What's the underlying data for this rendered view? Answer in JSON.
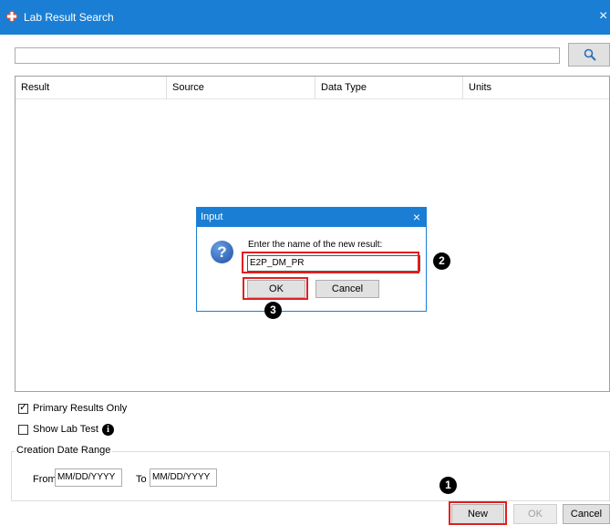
{
  "window": {
    "title": "Lab Result Search",
    "close_glyph": "×",
    "accent": "#1a7fd4"
  },
  "search": {
    "value": "",
    "button_icon": "search-icon"
  },
  "grid": {
    "columns": [
      "Result",
      "Source",
      "Data Type",
      "Units"
    ]
  },
  "options": {
    "primary_results_only": {
      "label": "Primary Results Only",
      "checked": true
    },
    "show_lab_test": {
      "label": "Show Lab Test",
      "checked": false,
      "info_glyph": "i"
    }
  },
  "date_range": {
    "title": "Creation Date Range",
    "from_label": "From",
    "from_value": "MM/DD/YYYY",
    "to_label": "To",
    "to_value": "MM/DD/YYYY"
  },
  "buttons": {
    "new": "New",
    "ok": "OK",
    "cancel": "Cancel"
  },
  "dialog": {
    "title": "Input",
    "close_glyph": "×",
    "icon_glyph": "?",
    "prompt": "Enter the name of the new result:",
    "input_value": "E2P_DM_PR",
    "ok": "OK",
    "cancel": "Cancel"
  },
  "annotations": {
    "step1": "1",
    "step2": "2",
    "step3": "3",
    "highlight_color": "#e02020"
  }
}
